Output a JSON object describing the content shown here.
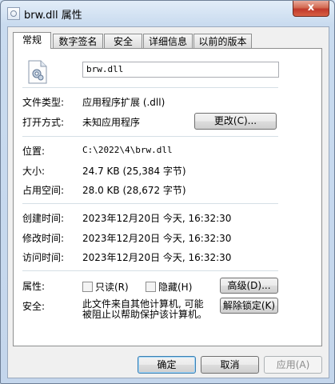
{
  "window": {
    "title": "brw.dll 属性",
    "close_glyph": "x"
  },
  "tabs": [
    {
      "label": "常规",
      "active": true
    },
    {
      "label": "数字签名"
    },
    {
      "label": "安全"
    },
    {
      "label": "详细信息"
    },
    {
      "label": "以前的版本"
    }
  ],
  "general": {
    "file_name": "brw.dll",
    "file_type_label": "文件类型:",
    "file_type_value": "应用程序扩展 (.dll)",
    "open_with_label": "打开方式:",
    "open_with_value": "未知应用程序",
    "change_button": "更改(C)...",
    "location_label": "位置:",
    "location_value": "C:\\2022\\4\\brw.dll",
    "size_label": "大小:",
    "size_value": "24.7 KB (25,384 字节)",
    "size_on_disk_label": "占用空间:",
    "size_on_disk_value": "28.0 KB (28,672 字节)",
    "created_label": "创建时间:",
    "created_value": "2023年12月20日 今天, 16:32:30",
    "modified_label": "修改时间:",
    "modified_value": "2023年12月20日 今天, 16:32:30",
    "accessed_label": "访问时间:",
    "accessed_value": "2023年12月20日 今天, 16:32:30",
    "attributes_label": "属性:",
    "readonly_label": "只读(R)",
    "hidden_label": "隐藏(H)",
    "advanced_button": "高级(D)...",
    "security_label": "安全:",
    "security_text_line1": "此文件来自其他计算机, 可能",
    "security_text_line2": "被阻止以帮助保护该计算机。",
    "unblock_button": "解除锁定(K)"
  },
  "footer": {
    "ok": "确定",
    "cancel": "取消",
    "apply": "应用(A)"
  }
}
